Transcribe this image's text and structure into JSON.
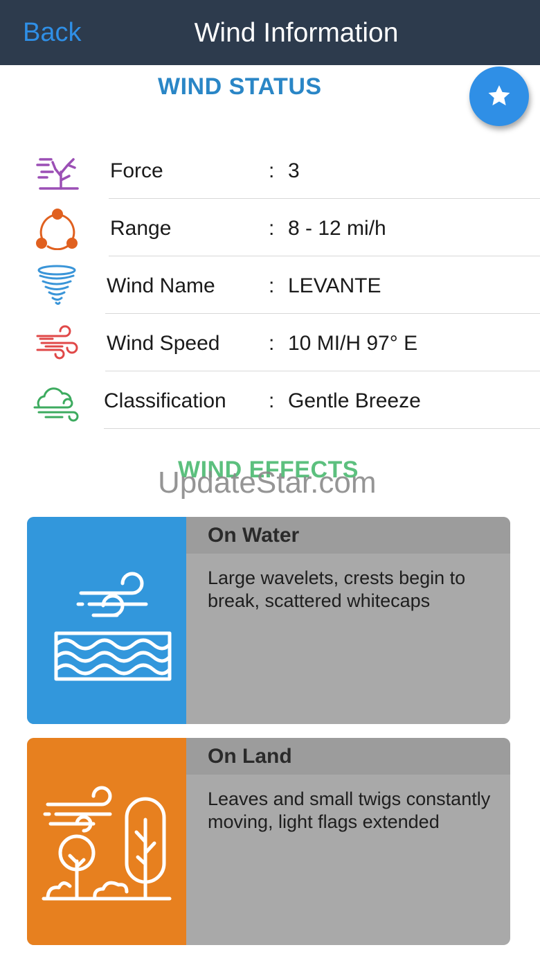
{
  "nav": {
    "back_label": "Back",
    "title": "Wind Information"
  },
  "status": {
    "title": "WIND STATUS",
    "rows": [
      {
        "label": "Force",
        "value": "3",
        "icon": "tree-wind-icon",
        "color": "#9b4fb5"
      },
      {
        "label": "Range",
        "value": "8 - 12  mi/h",
        "icon": "range-cycle-icon",
        "color": "#e0601f"
      },
      {
        "label": "Wind Name",
        "value": "LEVANTE",
        "icon": "tornado-icon",
        "color": "#3a95d8"
      },
      {
        "label": "Wind Speed",
        "value": "10 MI/H 97° E",
        "icon": "wind-speed-icon",
        "color": "#e04848"
      },
      {
        "label": "Classification",
        "value": "Gentle Breeze",
        "icon": "cloud-wind-icon",
        "color": "#3dab5f"
      }
    ],
    "separator": ":"
  },
  "fab": {
    "icon": "star-icon",
    "color": "#2f8fe6"
  },
  "effects": {
    "title": "WIND EFFECTS",
    "water": {
      "heading": "On Water",
      "description": "Large wavelets, crests begin to break, scattered whitecaps",
      "icon": "wind-over-water-icon",
      "color": "#3297dc"
    },
    "land": {
      "heading": "On Land",
      "description": "Leaves and small twigs constantly moving, light flags extended",
      "icon": "wind-over-trees-icon",
      "color": "#e7801f"
    }
  },
  "watermark": "UpdateStar.com"
}
